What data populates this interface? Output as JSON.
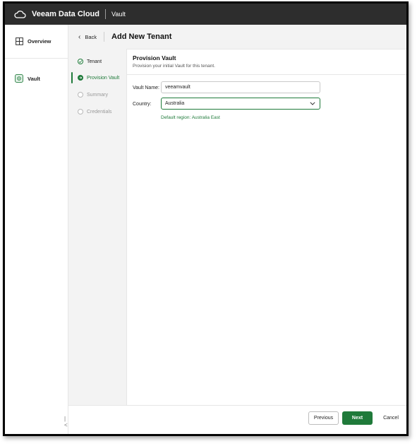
{
  "app": {
    "brand": "Veeam Data Cloud",
    "section": "Vault"
  },
  "nav": {
    "items": [
      {
        "label": "Overview",
        "icon": "grid-icon"
      },
      {
        "label": "Vault",
        "icon": "vault-icon"
      }
    ],
    "collapse_glyph": "|<"
  },
  "header": {
    "back_label": "Back",
    "title": "Add New Tenant"
  },
  "steps": [
    {
      "label": "Tenant",
      "state": "done"
    },
    {
      "label": "Provision Vault",
      "state": "active"
    },
    {
      "label": "Summary",
      "state": "pending"
    },
    {
      "label": "Credentials",
      "state": "pending"
    }
  ],
  "panel": {
    "title": "Provision Vault",
    "subtitle": "Provision your initial Vault for this tenant."
  },
  "form": {
    "vault_name_label": "Vault Name:",
    "vault_name_value": "veeamvault",
    "country_label": "Country:",
    "country_value": "Australia",
    "hint": "Default region: Australia East"
  },
  "footer": {
    "previous_label": "Previous",
    "next_label": "Next",
    "cancel_label": "Cancel"
  },
  "colors": {
    "accent": "#1f7a3a",
    "topbar": "#2d2d2d"
  }
}
